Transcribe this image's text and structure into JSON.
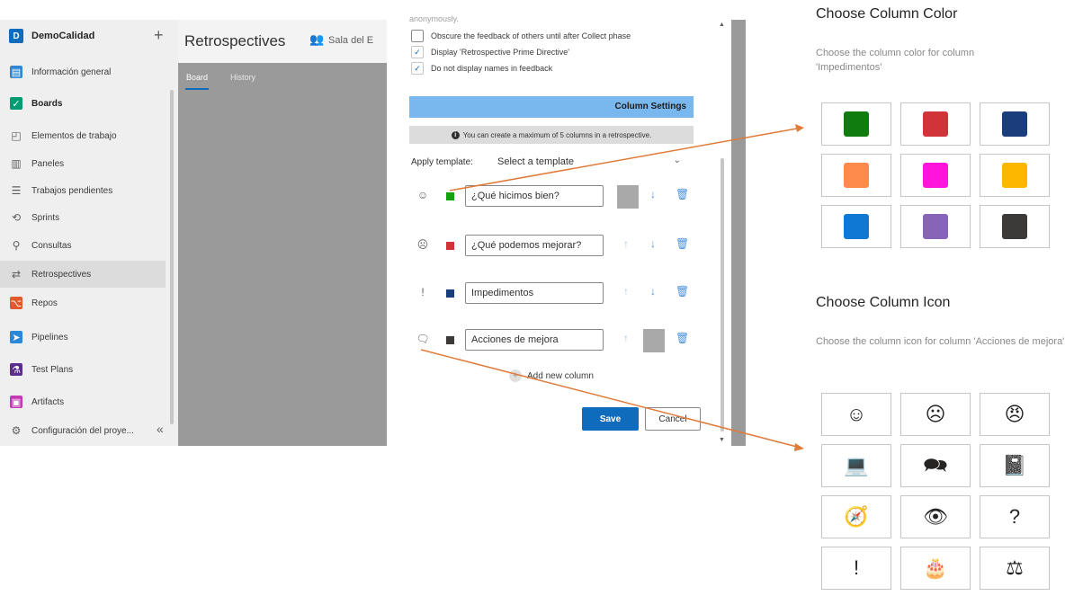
{
  "sidebar": {
    "project_initial": "D",
    "project_name": "DemoCalidad",
    "add_label": "+",
    "collapse_label": "«",
    "items": [
      {
        "label": "Información general",
        "icon": "overview-icon",
        "color": "#2b88d8"
      },
      {
        "label": "Boards",
        "icon": "boards-icon",
        "color": "#009b72"
      },
      {
        "label": "Elementos de trabajo",
        "icon": "work-items-icon"
      },
      {
        "label": "Paneles",
        "icon": "panels-icon"
      },
      {
        "label": "Trabajos pendientes",
        "icon": "backlog-icon"
      },
      {
        "label": "Sprints",
        "icon": "sprints-icon"
      },
      {
        "label": "Consultas",
        "icon": "queries-icon"
      },
      {
        "label": "Retrospectives",
        "icon": "retrospectives-icon"
      },
      {
        "label": "Repos",
        "icon": "repos-icon",
        "color": "#e05a2b"
      },
      {
        "label": "Pipelines",
        "icon": "pipelines-icon",
        "color": "#2b88d8"
      },
      {
        "label": "Test Plans",
        "icon": "test-plans-icon",
        "color": "#5c2d91"
      },
      {
        "label": "Artifacts",
        "icon": "artifacts-icon",
        "color": "#c239b3"
      },
      {
        "label": "Configuración del proye...",
        "icon": "settings-icon"
      }
    ]
  },
  "main": {
    "title": "Retrospectives",
    "team": "Sala del E",
    "tabs": [
      {
        "label": "Board"
      },
      {
        "label": "History"
      }
    ]
  },
  "dialog": {
    "cutoff_text": "anonymously.",
    "checkboxes": [
      {
        "label": "Obscure the feedback of others until after Collect phase",
        "checked": false
      },
      {
        "label": "Display 'Retrospective Prime Directive'",
        "checked": true
      },
      {
        "label": "Do not display names in feedback",
        "checked": true
      }
    ],
    "column_settings_label": "Column Settings",
    "info_text": "You can create a maximum of 5 columns in a retrospective.",
    "apply_template_label": "Apply template:",
    "template_value": "Select a template",
    "columns": [
      {
        "icon_glyph": "☺",
        "icon": "smile-icon",
        "color": "#13a10e",
        "title": "¿Qué hicimos bien?"
      },
      {
        "icon_glyph": "☹",
        "icon": "frown-icon",
        "color": "#d13438",
        "title": "¿Qué podemos mejorar?"
      },
      {
        "icon_glyph": "!",
        "icon": "exclamation-icon",
        "color": "#1a3d7c",
        "title": "Impedimentos"
      },
      {
        "icon_glyph": "🗨",
        "icon": "chat-icon",
        "color": "#3b3a39",
        "title": "Acciones de mejora"
      }
    ],
    "add_column_label": "Add new column",
    "save_label": "Save",
    "cancel_label": "Cancel"
  },
  "color_panel": {
    "title": "Choose Column Color",
    "description": "Choose the column color for column 'Impedimentos'",
    "colors": [
      "#107c10",
      "#d13438",
      "#1a3d7c",
      "#fe8a4c",
      "#ff14dc",
      "#fdb700",
      "#0f78d4",
      "#8764b8",
      "#3b3a39"
    ]
  },
  "icon_panel": {
    "title": "Choose Column Icon",
    "description": "Choose the column icon for column 'Acciones de mejora'",
    "icons": [
      {
        "glyph": "☺",
        "name": "smile-icon"
      },
      {
        "glyph": "☹",
        "name": "frown-icon"
      },
      {
        "glyph": "😠",
        "name": "angry-icon"
      },
      {
        "glyph": "💻",
        "name": "laptop-icon"
      },
      {
        "glyph": "🗪",
        "name": "chat-icon"
      },
      {
        "glyph": "📓",
        "name": "book-icon"
      },
      {
        "glyph": "🧭",
        "name": "compass-icon"
      },
      {
        "glyph": "👁",
        "name": "eye-icon"
      },
      {
        "glyph": "?",
        "name": "question-icon"
      },
      {
        "glyph": "!",
        "name": "exclamation-icon"
      },
      {
        "glyph": "🎂",
        "name": "cake-icon"
      },
      {
        "glyph": "⚖",
        "name": "balance-icon"
      }
    ]
  },
  "colors": {
    "arrow": "#e07b39",
    "accent": "#0f6cbd"
  }
}
